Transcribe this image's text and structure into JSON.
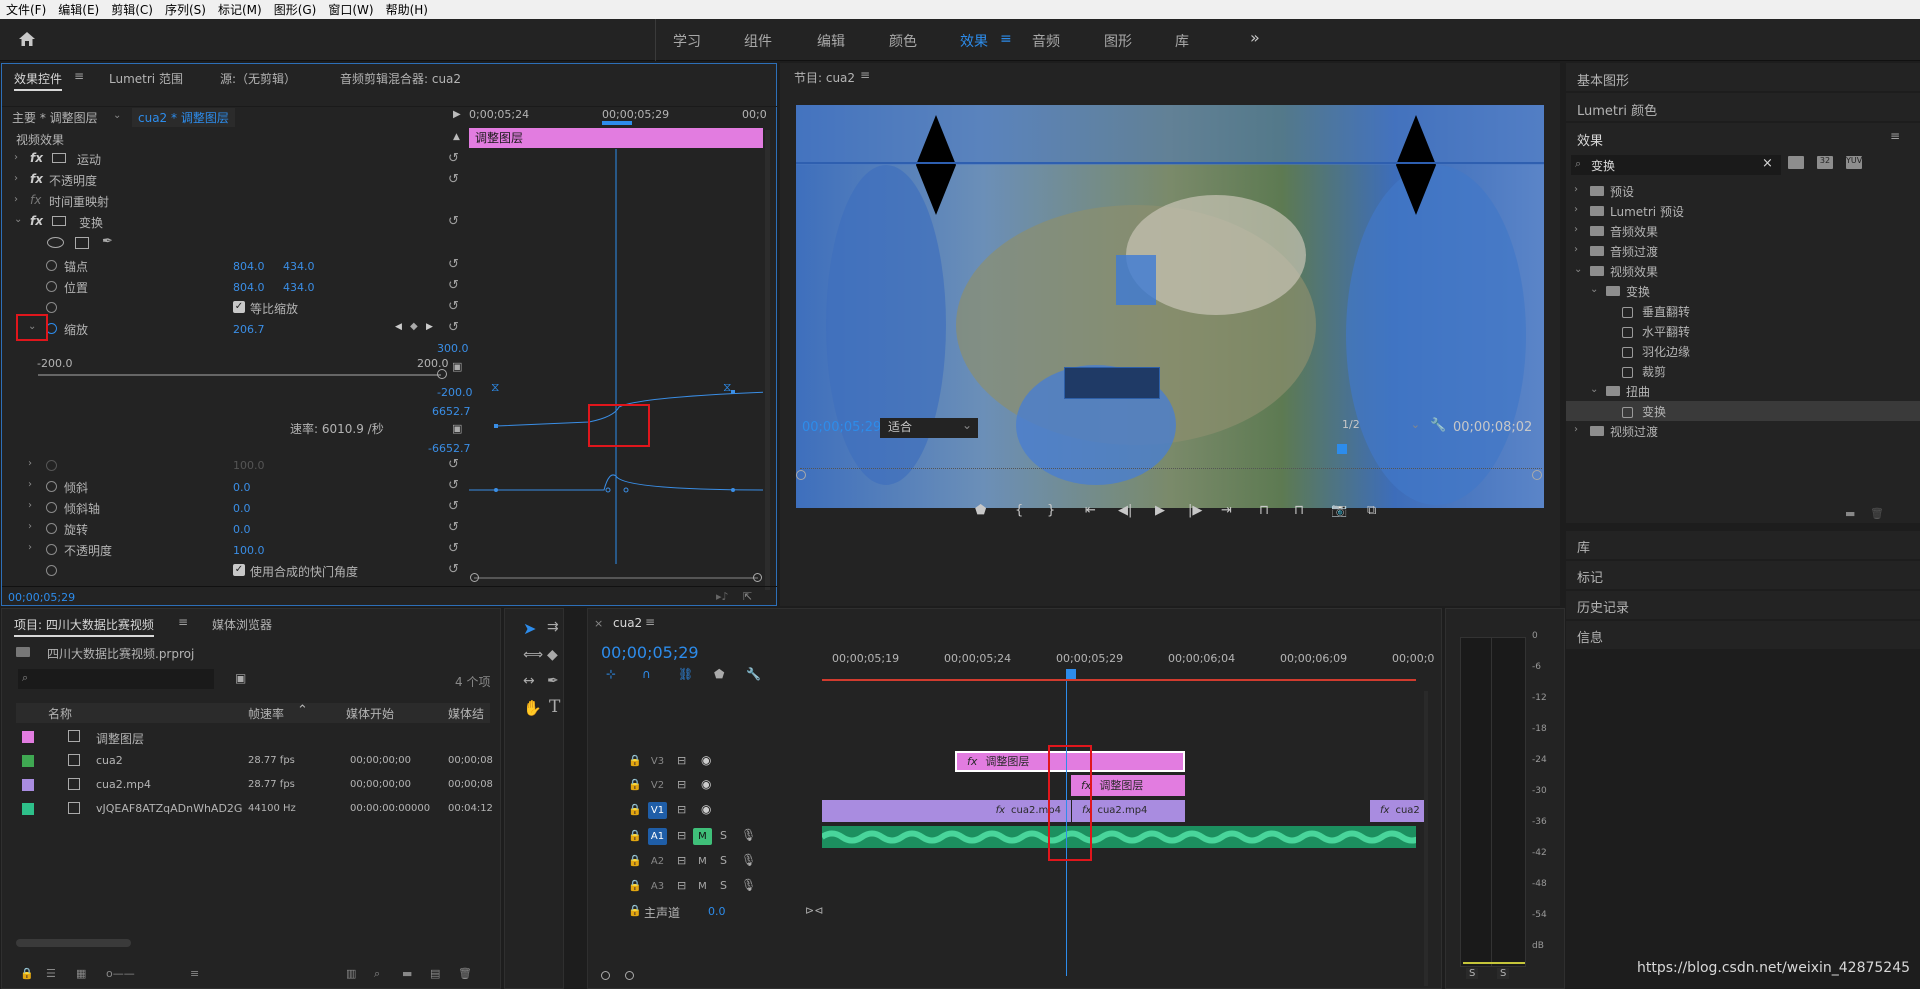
{
  "menu": [
    "文件(F)",
    "编辑(E)",
    "剪辑(C)",
    "序列(S)",
    "标记(M)",
    "图形(G)",
    "窗口(W)",
    "帮助(H)"
  ],
  "workspaces": [
    "学习",
    "组件",
    "编辑",
    "颜色",
    "效果",
    "音频",
    "图形",
    "库"
  ],
  "active_workspace": "效果",
  "effect_controls": {
    "tabs": [
      "效果控件",
      "Lumetri 范围",
      "源:（无剪辑）",
      "音频剪辑混合器: cua2"
    ],
    "master": "主要 * 调整图层",
    "clip": "cua2 * 调整图层",
    "section": "视频效果",
    "times": [
      "0;00;05;24",
      "00;00;05;29",
      "00;0"
    ],
    "clip_bar_label": "调整图层",
    "effects": [
      "运动",
      "不透明度",
      "时间重映射",
      "变换"
    ],
    "props": {
      "anchor_label": "锚点",
      "anchor_x": "804.0",
      "anchor_y": "434.0",
      "pos_label": "位置",
      "pos_x": "804.0",
      "pos_y": "434.0",
      "uniform_label": "等比缩放",
      "scale_label": "缩放",
      "scale_val": "206.7",
      "range_min": "-200.0",
      "range_max": "200.0",
      "graph_max": "300.0",
      "graph_min": "-200.0",
      "vel_max": "6652.7",
      "vel_min": "-6652.7",
      "rate_label": "速率: 6010.9 /秒",
      "dim_val": "100.0",
      "skew_label": "倾斜",
      "skew_val": "0.0",
      "skewaxis_label": "倾斜轴",
      "skewaxis_val": "0.0",
      "rot_label": "旋转",
      "rot_val": "0.0",
      "opacity_label": "不透明度",
      "opacity_val": "100.0",
      "shutter_label": "使用合成的快门角度"
    },
    "footer_time": "00;00;05;29"
  },
  "program": {
    "title": "节目: cua2",
    "timecode": "00;00;05;29",
    "fit": "适合",
    "resolution": "1/2",
    "duration": "00;00;08;02"
  },
  "project": {
    "tabs": [
      "项目: 四川大数据比赛视频",
      "媒体浏览器"
    ],
    "file": "四川大数据比赛视频.prproj",
    "count": "4 个项",
    "columns": [
      "名称",
      "帧速率",
      "媒体开始",
      "媒体结"
    ],
    "rows": [
      {
        "color": "#e27ce0",
        "name": "调整图层",
        "fps": "",
        "start": "",
        "end": ""
      },
      {
        "color": "#3fa852",
        "name": "cua2",
        "fps": "28.77 fps",
        "start": "00;00;00;00",
        "end": "00;00;08"
      },
      {
        "color": "#a98ce0",
        "name": "cua2.mp4",
        "fps": "28.77 fps",
        "start": "00;00;00;00",
        "end": "00;00;08"
      },
      {
        "color": "#2ec08a",
        "name": "vJQEAF8ATZqADnWhAD2G",
        "fps": "44100 Hz",
        "start": "00:00:00:00000",
        "end": "00:04:12"
      }
    ]
  },
  "timeline": {
    "tab": "cua2",
    "timecode": "00;00;05;29",
    "ruler": [
      "00;00;05;19",
      "00;00;05;24",
      "00;00;05;29",
      "00;00;06;04",
      "00;00;06;09",
      "00;00;0"
    ],
    "tracks": [
      "V3",
      "V2",
      "V1",
      "A1",
      "A2",
      "A3"
    ],
    "master": "主声道",
    "master_val": "0.0",
    "clip_v3": "调整图层",
    "clip_v2": "调整图层",
    "clip_v1a": "cua2.mp4",
    "clip_v1b": "cua2.mp4",
    "clip_v1c": "cua2"
  },
  "meter": {
    "scale": [
      "0",
      "-6",
      "-12",
      "-18",
      "-24",
      "-30",
      "-36",
      "-42",
      "-48",
      "-54",
      "dB"
    ],
    "solo": [
      "S",
      "S"
    ]
  },
  "right_panel": {
    "basic_graphics": "基本图形",
    "lumetri": "Lumetri 颜色",
    "effects_title": "效果",
    "search": "变换",
    "tree": [
      {
        "label": "预设",
        "level": 0,
        "type": "folder",
        "chev": "›"
      },
      {
        "label": "Lumetri 预设",
        "level": 0,
        "type": "folder",
        "chev": "›"
      },
      {
        "label": "音频效果",
        "level": 0,
        "type": "folder",
        "chev": "›"
      },
      {
        "label": "音频过渡",
        "level": 0,
        "type": "folder",
        "chev": "›"
      },
      {
        "label": "视频效果",
        "level": 0,
        "type": "folder",
        "chev": "⌄"
      },
      {
        "label": "变换",
        "level": 1,
        "type": "folder",
        "chev": "⌄"
      },
      {
        "label": "垂直翻转",
        "level": 2,
        "type": "fx",
        "chev": ""
      },
      {
        "label": "水平翻转",
        "level": 2,
        "type": "fx",
        "chev": ""
      },
      {
        "label": "羽化边缘",
        "level": 2,
        "type": "fx",
        "chev": ""
      },
      {
        "label": "裁剪",
        "level": 2,
        "type": "fx",
        "chev": ""
      },
      {
        "label": "扭曲",
        "level": 1,
        "type": "folder",
        "chev": "⌄"
      },
      {
        "label": "变换",
        "level": 2,
        "type": "fx",
        "chev": ""
      },
      {
        "label": "视频过渡",
        "level": 0,
        "type": "folder",
        "chev": "›"
      }
    ],
    "sections": [
      "库",
      "标记",
      "历史记录",
      "信息"
    ]
  },
  "watermark": "https://blog.csdn.net/weixin_42875245"
}
